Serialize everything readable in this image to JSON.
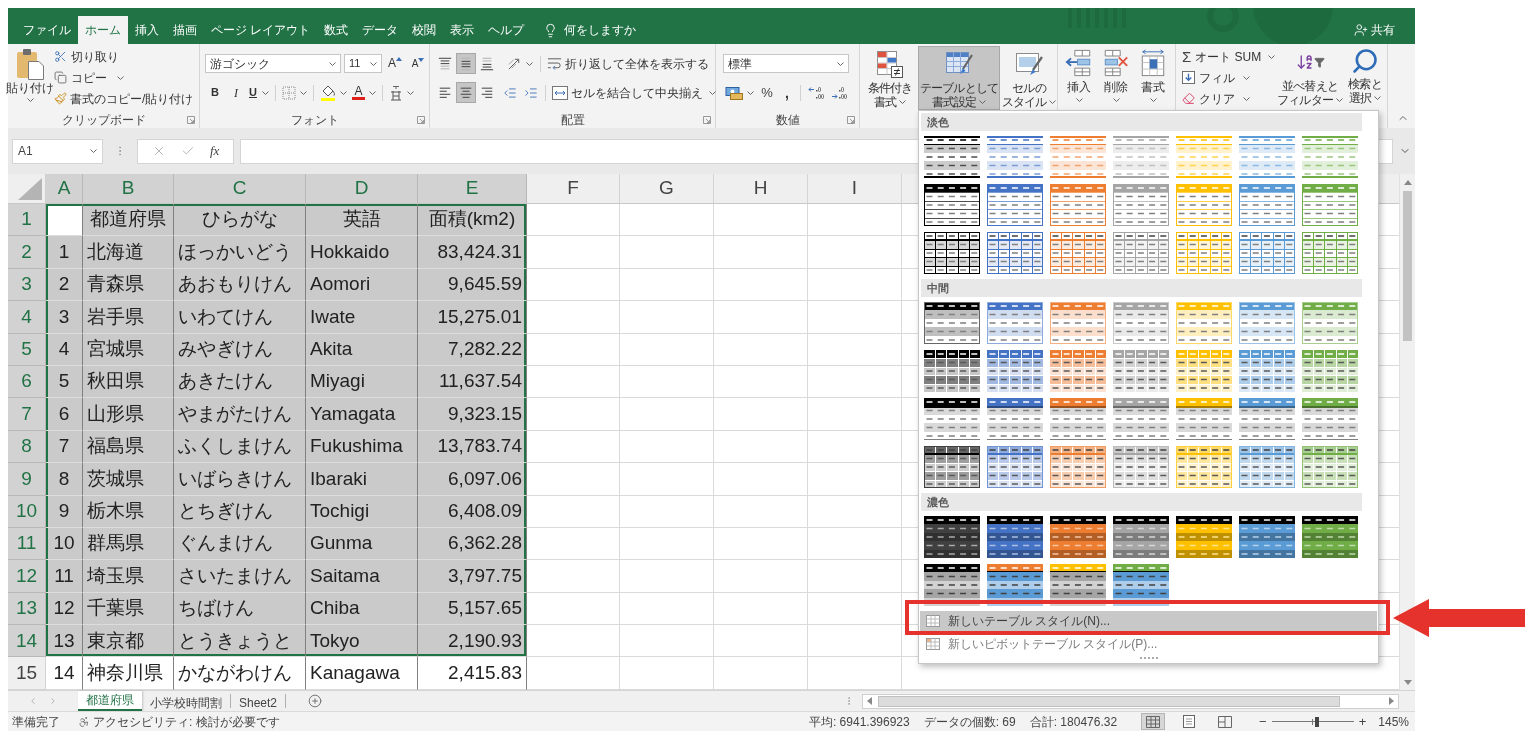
{
  "title_bar": {
    "tabs": [
      {
        "label": "ファイル",
        "selected": false
      },
      {
        "label": "ホーム",
        "selected": true
      },
      {
        "label": "挿入",
        "selected": false
      },
      {
        "label": "描画",
        "selected": false
      },
      {
        "label": "ページ レイアウト",
        "selected": false
      },
      {
        "label": "数式",
        "selected": false
      },
      {
        "label": "データ",
        "selected": false
      },
      {
        "label": "校閲",
        "selected": false
      },
      {
        "label": "表示",
        "selected": false
      },
      {
        "label": "ヘルプ",
        "selected": false
      }
    ],
    "tell_me": {
      "placeholder": "何をしますか"
    },
    "share": "共有"
  },
  "ribbon": {
    "clipboard": {
      "label": "クリップボード",
      "paste": "貼り付け",
      "cut": "切り取り",
      "copy": "コピー",
      "format_painter": "書式のコピー/貼り付け"
    },
    "font": {
      "label": "フォント",
      "name": "游ゴシック",
      "size": "11",
      "grow": "A",
      "shrink": "A",
      "bold": "B",
      "italic": "I",
      "underline": "U",
      "font_color": "A"
    },
    "alignment": {
      "label": "配置",
      "vertical": [
        {
          "kind": "top",
          "selected": false
        },
        {
          "kind": "middle",
          "selected": true
        },
        {
          "kind": "bottom",
          "selected": false
        }
      ],
      "horizontal": [
        {
          "kind": "left",
          "selected": false
        },
        {
          "kind": "center",
          "selected": true
        },
        {
          "kind": "right",
          "selected": false
        }
      ],
      "wrap_text": "折り返して全体を表示する",
      "merge": "セルを結合して中央揃え"
    },
    "number": {
      "label": "数値",
      "format": "標準",
      "percent": "%",
      "comma": ","
    },
    "styles": [
      {
        "kind": "conditional",
        "lines": [
          "条件付き",
          "書式"
        ],
        "selected": false
      },
      {
        "kind": "table",
        "lines": [
          "テーブルとして",
          "書式設定"
        ],
        "selected": true
      },
      {
        "kind": "cell",
        "lines": [
          "セルの",
          "スタイル"
        ],
        "selected": false
      }
    ],
    "cells": [
      {
        "kind": "insert",
        "label": "挿入"
      },
      {
        "kind": "delete",
        "label": "削除"
      },
      {
        "kind": "format",
        "label": "書式"
      }
    ],
    "editing": {
      "autosum_symbol": "Σ",
      "autosum": "オート SUM",
      "fill": "フィル",
      "clear": "クリア",
      "sort": [
        "並べ替えと",
        "フィルター"
      ],
      "find": [
        "検索と",
        "選択"
      ]
    }
  },
  "formula_bar": {
    "name_box": "A1",
    "fx": "fx"
  },
  "sheet": {
    "columns": [
      {
        "label": "A",
        "selected": true
      },
      {
        "label": "B",
        "selected": true
      },
      {
        "label": "C",
        "selected": true
      },
      {
        "label": "D",
        "selected": true
      },
      {
        "label": "E",
        "selected": true
      },
      {
        "label": "F",
        "selected": false
      },
      {
        "label": "G",
        "selected": false
      },
      {
        "label": "H",
        "selected": false
      },
      {
        "label": "I",
        "selected": false
      }
    ],
    "rows": [
      {
        "header": "1",
        "selected": true,
        "kind": "header",
        "cells": [
          {
            "active": true
          },
          "都道府県",
          "ひらがな",
          "英語",
          "面積(km2)"
        ]
      },
      {
        "header": "2",
        "selected": true,
        "kind": "data",
        "cells": [
          "1",
          "北海道",
          "ほっかいどう",
          "Hokkaido",
          "83,424.31"
        ]
      },
      {
        "header": "3",
        "selected": true,
        "kind": "data",
        "cells": [
          "2",
          "青森県",
          "あおもりけん",
          "Aomori",
          "9,645.59"
        ]
      },
      {
        "header": "4",
        "selected": true,
        "kind": "data",
        "cells": [
          "3",
          "岩手県",
          "いわてけん",
          "Iwate",
          "15,275.01"
        ]
      },
      {
        "header": "5",
        "selected": true,
        "kind": "data",
        "cells": [
          "4",
          "宮城県",
          "みやぎけん",
          "Akita",
          "7,282.22"
        ]
      },
      {
        "header": "6",
        "selected": true,
        "kind": "data",
        "cells": [
          "5",
          "秋田県",
          "あきたけん",
          "Miyagi",
          "11,637.54"
        ]
      },
      {
        "header": "7",
        "selected": true,
        "kind": "data",
        "cells": [
          "6",
          "山形県",
          "やまがたけん",
          "Yamagata",
          "9,323.15"
        ]
      },
      {
        "header": "8",
        "selected": true,
        "kind": "data",
        "cells": [
          "7",
          "福島県",
          "ふくしまけん",
          "Fukushima",
          "13,783.74"
        ]
      },
      {
        "header": "9",
        "selected": true,
        "kind": "data",
        "cells": [
          "8",
          "茨城県",
          "いばらきけん",
          "Ibaraki",
          "6,097.06"
        ]
      },
      {
        "header": "10",
        "selected": true,
        "kind": "data",
        "cells": [
          "9",
          "栃木県",
          "とちぎけん",
          "Tochigi",
          "6,408.09"
        ]
      },
      {
        "header": "11",
        "selected": true,
        "kind": "data",
        "cells": [
          "10",
          "群馬県",
          "ぐんまけん",
          "Gunma",
          "6,362.28"
        ]
      },
      {
        "header": "12",
        "selected": true,
        "kind": "data",
        "cells": [
          "11",
          "埼玉県",
          "さいたまけん",
          "Saitama",
          "3,797.75"
        ]
      },
      {
        "header": "13",
        "selected": true,
        "kind": "data",
        "cells": [
          "12",
          "千葉県",
          "ちばけん",
          "Chiba",
          "5,157.65"
        ]
      },
      {
        "header": "14",
        "selected": true,
        "kind": "data",
        "cells": [
          "13",
          "東京都",
          "とうきょうと",
          "Tokyo",
          "2,190.93"
        ]
      },
      {
        "header": "15",
        "selected": false,
        "kind": "data",
        "cells": [
          "14",
          "神奈川県",
          "かながわけん",
          "Kanagawa",
          "2,415.83"
        ]
      }
    ]
  },
  "sheet_tabs": [
    {
      "label": "都道府県",
      "selected": true
    },
    {
      "label": "小学校時間割",
      "selected": false
    },
    {
      "label": "Sheet2",
      "selected": false
    }
  ],
  "status_bar": {
    "ready": "準備完了",
    "accessibility": "アクセシビリティ: 検討が必要です",
    "average": "平均: 6941.396923",
    "count": "データの個数: 69",
    "sum": "合計: 180476.32",
    "views": [
      {
        "kind": "normal",
        "selected": true
      },
      {
        "kind": "page-layout",
        "selected": false
      },
      {
        "kind": "page-break",
        "selected": false
      }
    ],
    "zoom": {
      "minus": "−",
      "level": 0.55,
      "plus": "+",
      "reading": "145%"
    }
  },
  "table_style_gallery": {
    "sections": [
      {
        "title": "淡色",
        "styles": [
          {
            "kind": "light-banded",
            "color": "#000000"
          },
          {
            "kind": "light-banded",
            "color": "#4472c4"
          },
          {
            "kind": "light-banded",
            "color": "#ed7d31"
          },
          {
            "kind": "light-banded",
            "color": "#a5a5a5"
          },
          {
            "kind": "light-banded",
            "color": "#ffc000"
          },
          {
            "kind": "light-banded",
            "color": "#5b9bd5"
          },
          {
            "kind": "light-banded",
            "color": "#70ad47"
          },
          {
            "kind": "light-header",
            "color": "#000000"
          },
          {
            "kind": "light-header",
            "color": "#4472c4"
          },
          {
            "kind": "light-header",
            "color": "#ed7d31"
          },
          {
            "kind": "light-header",
            "color": "#a5a5a5"
          },
          {
            "kind": "light-header",
            "color": "#ffc000"
          },
          {
            "kind": "light-header",
            "color": "#5b9bd5"
          },
          {
            "kind": "light-header",
            "color": "#70ad47"
          },
          {
            "kind": "light-grid",
            "color": "#000000"
          },
          {
            "kind": "light-grid",
            "color": "#4472c4"
          },
          {
            "kind": "light-grid",
            "color": "#ed7d31"
          },
          {
            "kind": "light-grid",
            "color": "#a5a5a5"
          },
          {
            "kind": "light-grid",
            "color": "#ffc000"
          },
          {
            "kind": "light-grid",
            "color": "#5b9bd5"
          },
          {
            "kind": "light-grid",
            "color": "#70ad47"
          }
        ]
      },
      {
        "title": "中間",
        "styles": [
          {
            "kind": "medium-banded",
            "color": "#000000"
          },
          {
            "kind": "medium-banded",
            "color": "#4472c4"
          },
          {
            "kind": "medium-banded",
            "color": "#ed7d31"
          },
          {
            "kind": "medium-banded",
            "color": "#a5a5a5"
          },
          {
            "kind": "medium-banded",
            "color": "#ffc000"
          },
          {
            "kind": "medium-banded",
            "color": "#5b9bd5"
          },
          {
            "kind": "medium-banded",
            "color": "#70ad47"
          },
          {
            "kind": "medium-grid",
            "color": "#000000"
          },
          {
            "kind": "medium-grid",
            "color": "#4472c4"
          },
          {
            "kind": "medium-grid",
            "color": "#ed7d31"
          },
          {
            "kind": "medium-grid",
            "color": "#a5a5a5"
          },
          {
            "kind": "medium-grid",
            "color": "#ffc000"
          },
          {
            "kind": "medium-grid",
            "color": "#5b9bd5"
          },
          {
            "kind": "medium-grid",
            "color": "#70ad47"
          },
          {
            "kind": "medium-plain",
            "color": "#000000"
          },
          {
            "kind": "medium-plain",
            "color": "#4472c4"
          },
          {
            "kind": "medium-plain",
            "color": "#ed7d31"
          },
          {
            "kind": "medium-plain",
            "color": "#a5a5a5"
          },
          {
            "kind": "medium-plain",
            "color": "#ffc000"
          },
          {
            "kind": "medium-plain",
            "color": "#5b9bd5"
          },
          {
            "kind": "medium-plain",
            "color": "#70ad47"
          },
          {
            "kind": "medium-tinted-grid",
            "color": "#000000"
          },
          {
            "kind": "medium-tinted-grid",
            "color": "#4472c4"
          },
          {
            "kind": "medium-tinted-grid",
            "color": "#ed7d31"
          },
          {
            "kind": "medium-tinted-grid",
            "color": "#a5a5a5"
          },
          {
            "kind": "medium-tinted-grid",
            "color": "#ffc000"
          },
          {
            "kind": "medium-tinted-grid",
            "color": "#5b9bd5"
          },
          {
            "kind": "medium-tinted-grid",
            "color": "#70ad47"
          }
        ]
      },
      {
        "title": "濃色",
        "styles": [
          {
            "kind": "dark-banded",
            "color": "#404040"
          },
          {
            "kind": "dark-banded",
            "color": "#4472c4"
          },
          {
            "kind": "dark-banded",
            "color": "#ed7d31"
          },
          {
            "kind": "dark-banded",
            "color": "#a5a5a5"
          },
          {
            "kind": "dark-banded",
            "color": "#ffc000"
          },
          {
            "kind": "dark-banded",
            "color": "#5b9bd5"
          },
          {
            "kind": "dark-banded",
            "color": "#70ad47"
          },
          {
            "kind": "dark-contrast",
            "color": "#000000",
            "band": {
              "color": "#a5a5a5"
            }
          },
          {
            "kind": "dark-contrast",
            "color": "#ed7d31",
            "band": {
              "color": "#5b9bd5"
            }
          },
          {
            "kind": "dark-contrast",
            "color": "#ffc000",
            "band": {
              "color": "#a5a5a5"
            }
          },
          {
            "kind": "dark-contrast",
            "color": "#70ad47",
            "band": {
              "color": "#5b9bd5"
            }
          }
        ]
      }
    ],
    "menu": [
      {
        "kind": "table",
        "label": "新しいテーブル スタイル(N)...",
        "selected": true
      },
      {
        "kind": "pivot",
        "label": "新しいピボットテーブル スタイル(P)...",
        "selected": false
      }
    ]
  }
}
